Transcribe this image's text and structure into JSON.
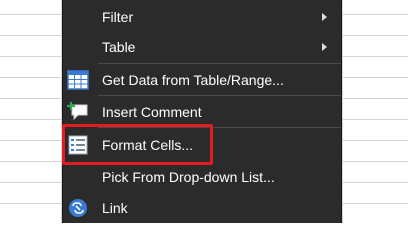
{
  "context_menu": {
    "items": [
      {
        "label": "Filter",
        "submenu": true,
        "icon": null
      },
      {
        "label": "Table",
        "submenu": true,
        "icon": null
      },
      {
        "label": "Get Data from Table/Range...",
        "submenu": false,
        "icon": "table-grid-icon"
      },
      {
        "label": "Insert Comment",
        "submenu": false,
        "icon": "comment-add-icon"
      },
      {
        "label": "Format Cells...",
        "submenu": false,
        "icon": "format-cells-icon"
      },
      {
        "label": "Pick From Drop-down List...",
        "submenu": false,
        "icon": null
      },
      {
        "label": "Link",
        "submenu": false,
        "icon": "link-icon"
      }
    ]
  },
  "colors": {
    "menu_background": "#2b2b2b",
    "menu_text": "#ffffff",
    "highlight_box": "#e31b23",
    "icon_blue": "#3a7bd5",
    "icon_green": "#2fa84f"
  }
}
